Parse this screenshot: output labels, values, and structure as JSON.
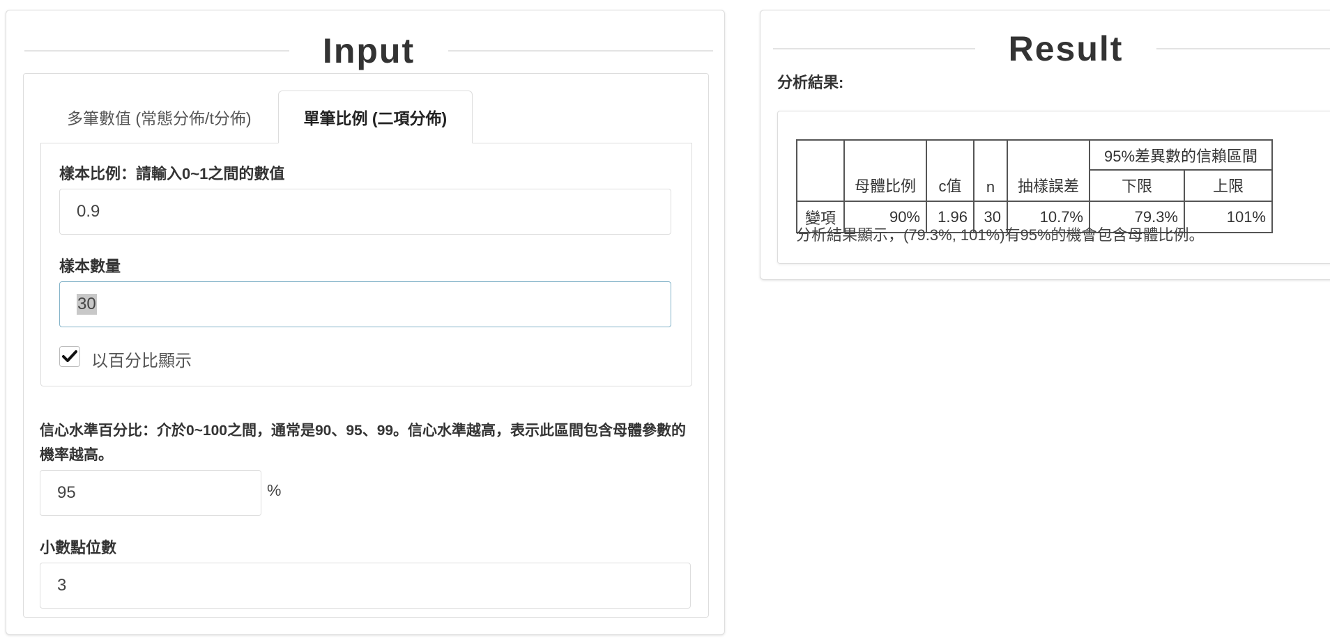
{
  "input": {
    "title": "Input",
    "tabs": [
      {
        "label": "多筆數值 (常態分佈/t分佈)",
        "active": false
      },
      {
        "label": "單筆比例 (二項分佈)",
        "active": true
      }
    ],
    "sample_ratio": {
      "label": "樣本比例：請輸入0~1之間的數值",
      "value": "0.9"
    },
    "sample_size": {
      "label": "樣本數量",
      "value": "30"
    },
    "show_percent": {
      "label": "以百分比顯示",
      "checked": true
    },
    "confidence": {
      "help": "信心水準百分比：介於0~100之間，通常是90、95、99。信心水準越高，表示此區間包含母體參數的機率越高。",
      "value": "95",
      "unit": "%"
    },
    "decimals": {
      "label": "小數點位數",
      "value": "3"
    }
  },
  "result": {
    "title": "Result",
    "heading": "分析結果:",
    "table": {
      "ci_header": "95%差異數的信賴區間",
      "headers": [
        "",
        "母體比例",
        "c值",
        "n",
        "抽樣誤差",
        "下限",
        "上限"
      ],
      "rows": [
        [
          "變項",
          "90%",
          "1.96",
          "30",
          "10.7%",
          "79.3%",
          "101%"
        ]
      ]
    },
    "summary": "分析結果顯示，(79.3%, 101%)有95%的機會包含母體比例。"
  },
  "colors": {
    "border": "#dddddd",
    "focus_border": "#84b4c9",
    "text": "#333333",
    "selection": "#c8c8c8"
  }
}
